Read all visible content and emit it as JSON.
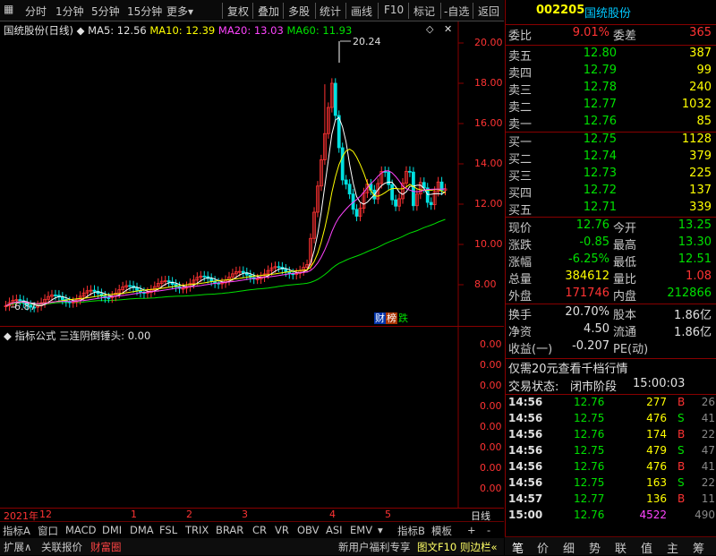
{
  "toolbar": {
    "left_items": [
      "分时",
      "1分钟",
      "5分钟",
      "15分钟",
      "更多"
    ],
    "right_items": [
      "复权",
      "叠加",
      "多股",
      "统计",
      "画线",
      "F10",
      "标记",
      "-自选",
      "返回"
    ]
  },
  "chart": {
    "stock_label": "国统股份(日线)",
    "ma5": "MA5: 12.56",
    "ma10": "MA10: 12.39",
    "ma20": "MA20: 13.03",
    "ma60": "MA60: 11.93",
    "high_label": "20.24",
    "low_label": "6.87",
    "yticks": [
      "20.00",
      "18.00",
      "16.00",
      "14.00",
      "12.00",
      "10.00",
      "8.00"
    ],
    "badges": [
      "财",
      "榜",
      "跌"
    ],
    "colors": {
      "ma5": "#ffffff",
      "ma10": "#ffff00",
      "ma20": "#ff44ff",
      "ma60": "#00e000",
      "up": "#ff3333",
      "down": "#00e0e0"
    }
  },
  "indicator": {
    "label": "指标公式",
    "formula": "三连阴倒锤头: 0.00",
    "yticks": [
      "0.00",
      "0.00",
      "0.00",
      "0.00",
      "0.00",
      "0.00",
      "0.00",
      "0.00"
    ]
  },
  "xaxis": {
    "labels": [
      "2021年",
      "12",
      "1",
      "2",
      "3",
      "4",
      "5"
    ],
    "right_label": "日线"
  },
  "tabs": [
    "指标A",
    "窗口",
    "MACD",
    "DMI",
    "DMA",
    "FSL",
    "TRIX",
    "BRAR",
    "CR",
    "VR",
    "OBV",
    "ASI",
    "EMV"
  ],
  "tabs_right": [
    "指标B",
    "模板",
    "+",
    "-"
  ],
  "bottombar": {
    "left": [
      "扩展∧",
      "关联报价",
      "财富圈"
    ],
    "right": [
      "新用户福利专享",
      "图文F10",
      "则边栏«"
    ]
  },
  "quote": {
    "code": "002205",
    "name": "国统股份",
    "webi_label": "委比",
    "webi": "9.01%",
    "weicha_label": "委差",
    "weicha": "365",
    "asks": [
      {
        "label": "卖五",
        "price": "12.80",
        "vol": "387"
      },
      {
        "label": "卖四",
        "price": "12.79",
        "vol": "99"
      },
      {
        "label": "卖三",
        "price": "12.78",
        "vol": "240"
      },
      {
        "label": "卖二",
        "price": "12.77",
        "vol": "1032"
      },
      {
        "label": "卖一",
        "price": "12.76",
        "vol": "85"
      }
    ],
    "bids": [
      {
        "label": "买一",
        "price": "12.75",
        "vol": "1128"
      },
      {
        "label": "买二",
        "price": "12.74",
        "vol": "379"
      },
      {
        "label": "买三",
        "price": "12.73",
        "vol": "225"
      },
      {
        "label": "买四",
        "price": "12.72",
        "vol": "137"
      },
      {
        "label": "买五",
        "price": "12.71",
        "vol": "339"
      }
    ],
    "stats": [
      {
        "l1": "现价",
        "v1": "12.76",
        "c1": "green",
        "l2": "今开",
        "v2": "13.25",
        "c2": "green"
      },
      {
        "l1": "涨跌",
        "v1": "-0.85",
        "c1": "green",
        "l2": "最高",
        "v2": "13.30",
        "c2": "green"
      },
      {
        "l1": "涨幅",
        "v1": "-6.25%",
        "c1": "green",
        "l2": "最低",
        "v2": "12.51",
        "c2": "green"
      },
      {
        "l1": "总量",
        "v1": "384612",
        "c1": "yellow",
        "l2": "量比",
        "v2": "1.08",
        "c2": "red"
      },
      {
        "l1": "外盘",
        "v1": "171746",
        "c1": "red",
        "l2": "内盘",
        "v2": "212866",
        "c2": "green"
      }
    ],
    "stats2": [
      {
        "l1": "换手",
        "v1": "20.70%",
        "l2": "股本",
        "v2": "1.86亿"
      },
      {
        "l1": "净资",
        "v1": "4.50",
        "l2": "流通",
        "v2": "1.86亿"
      },
      {
        "l1": "收益(一)",
        "v1": "-0.207",
        "l2": "PE(动)",
        "v2": ""
      }
    ],
    "promo": "仅需20元查看千档行情",
    "status_label": "交易状态:",
    "status": "闭市阶段",
    "status_time": "15:00:03"
  },
  "ticks": [
    {
      "time": "14:56",
      "price": "12.76",
      "vol": "277",
      "bs": "B",
      "n": "26"
    },
    {
      "time": "14:56",
      "price": "12.75",
      "vol": "476",
      "bs": "S",
      "n": "41"
    },
    {
      "time": "14:56",
      "price": "12.76",
      "vol": "174",
      "bs": "B",
      "n": "22"
    },
    {
      "time": "14:56",
      "price": "12.75",
      "vol": "479",
      "bs": "S",
      "n": "47"
    },
    {
      "time": "14:56",
      "price": "12.76",
      "vol": "476",
      "bs": "B",
      "n": "41"
    },
    {
      "time": "14:56",
      "price": "12.75",
      "vol": "163",
      "bs": "S",
      "n": "22"
    },
    {
      "time": "14:57",
      "price": "12.77",
      "vol": "136",
      "bs": "B",
      "n": "11"
    },
    {
      "time": "15:00",
      "price": "12.76",
      "vol": "4522",
      "bs": "",
      "n": "490"
    }
  ],
  "right_tabs": [
    "笔",
    "价",
    "细",
    "势",
    "联",
    "值",
    "主",
    "筹"
  ]
}
